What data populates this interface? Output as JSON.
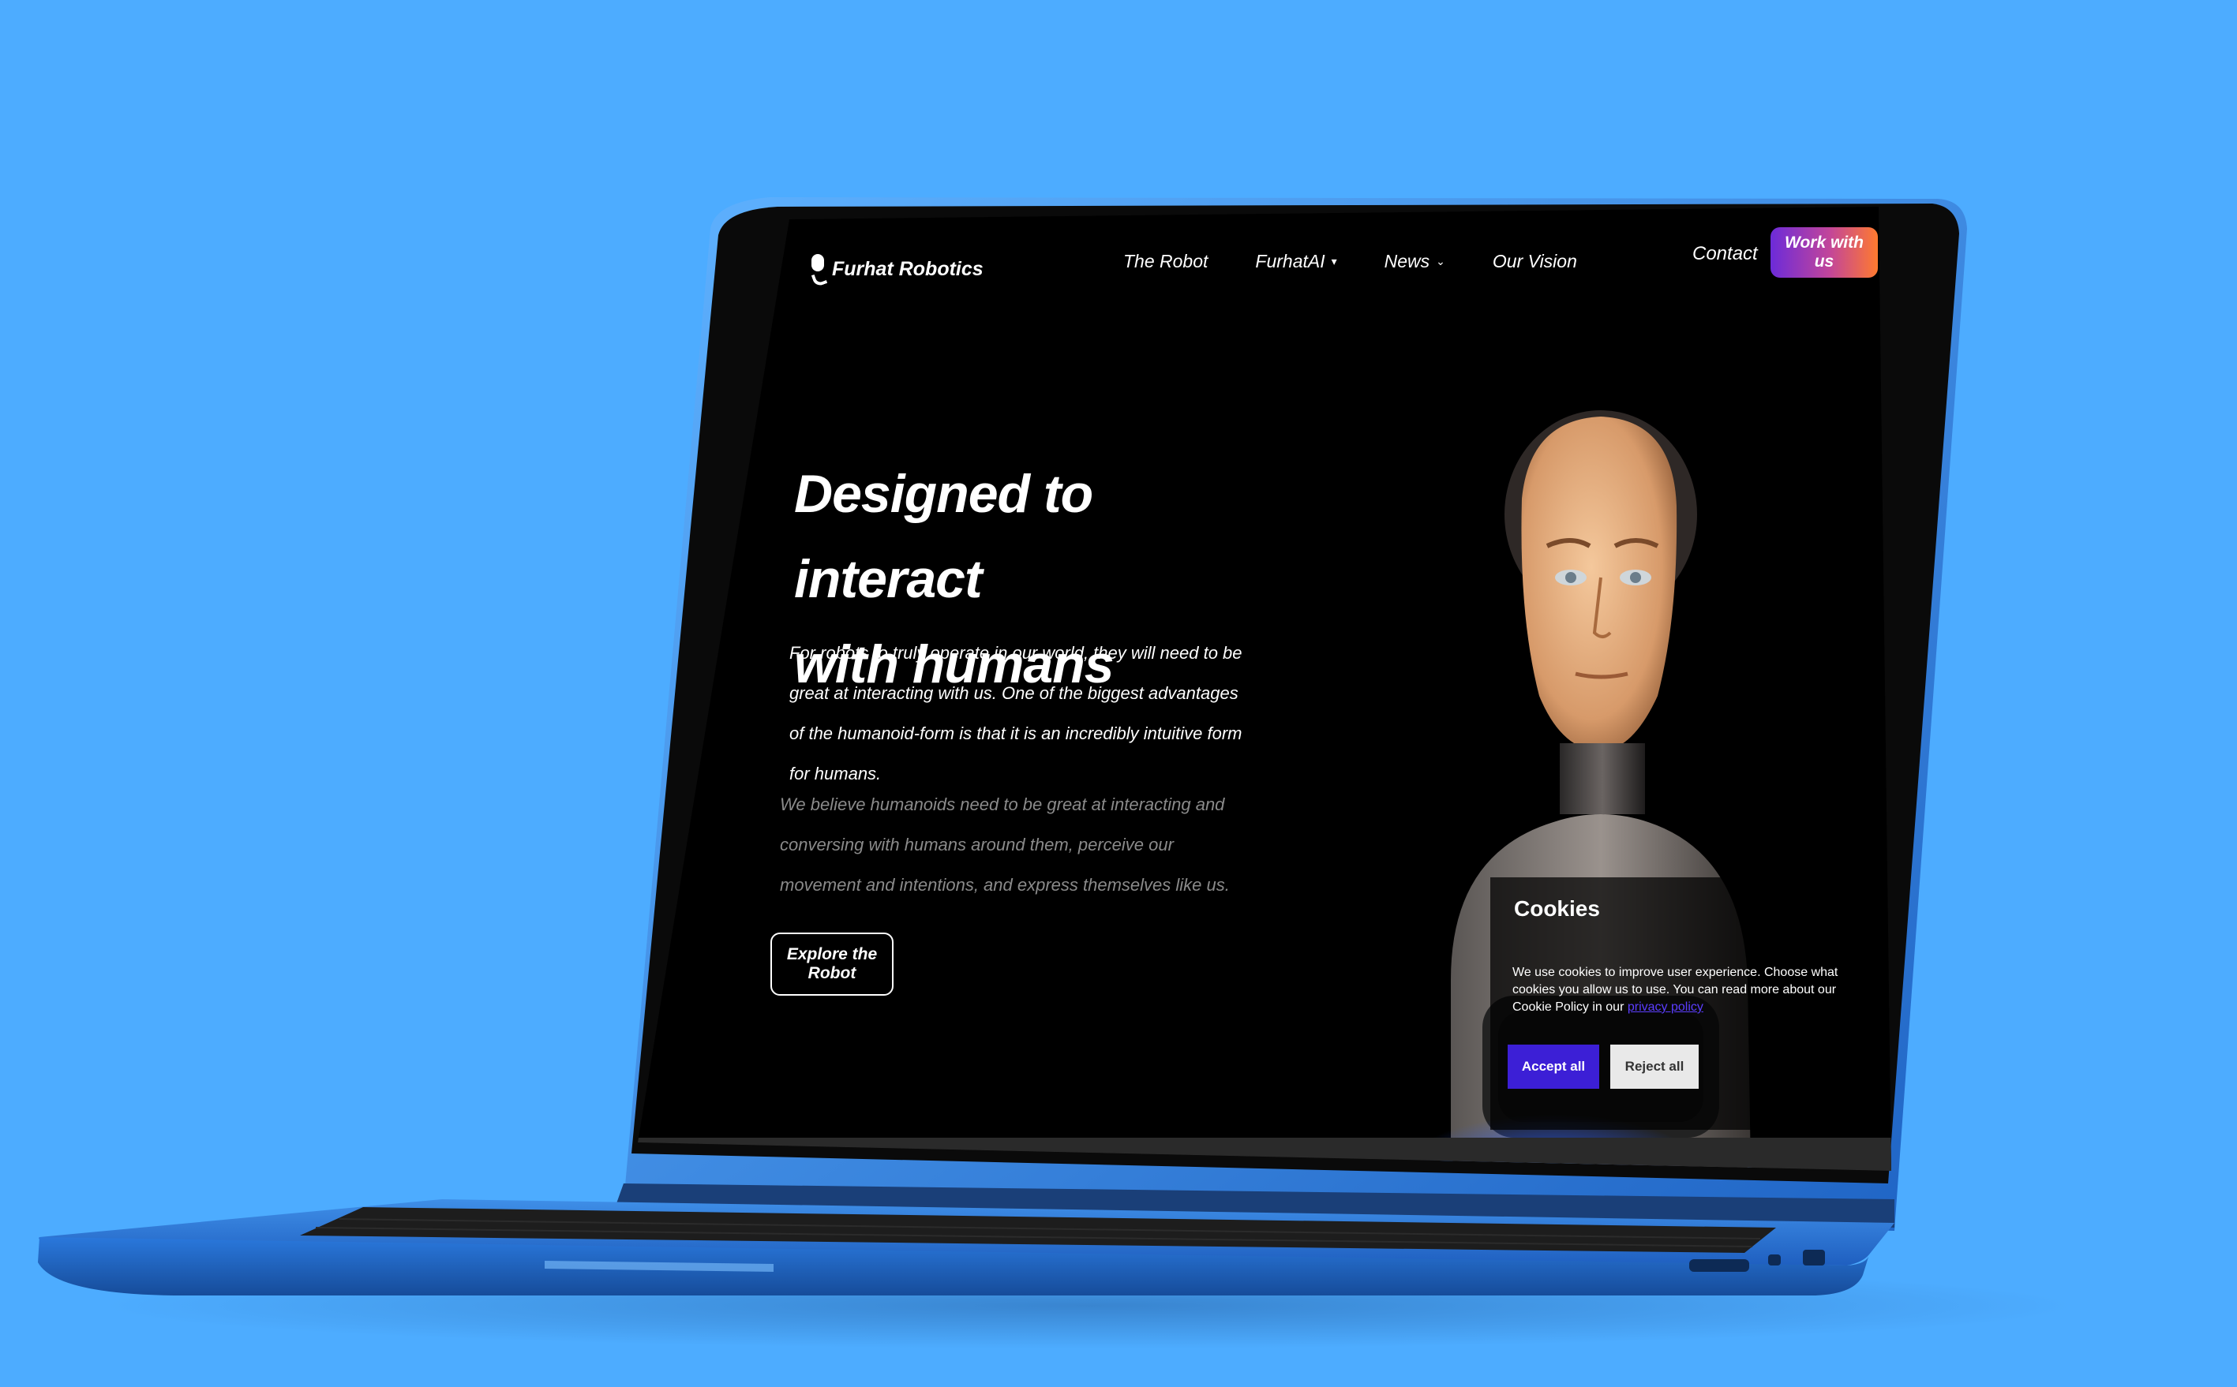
{
  "nav": {
    "logo": "Furhat Robotics",
    "links": [
      "The Robot",
      "FurhatAI",
      "News",
      "Our Vision"
    ],
    "contact": "Contact",
    "cta": "Work with us"
  },
  "hero": {
    "title_line1": "Designed to interact",
    "title_line2": "with humans",
    "paragraph1": "For robots to truly operate in our world, they will need to be great at interacting with us. One of the biggest advantages of the humanoid-form is that it is an incredibly intuitive form for humans.",
    "paragraph2": "We believe humanoids need to be great at interacting and conversing with humans around them, perceive our movement and intentions, and express themselves like us.",
    "button": "Explore the Robot"
  },
  "cookies": {
    "title": "Cookies",
    "text": "We use cookies to improve user experience. Choose what cookies you allow us to use. You can read more about our Cookie Policy in our",
    "link": "privacy policy",
    "accept": "Accept all",
    "reject": "Reject all"
  },
  "colors": {
    "background": "#4dacff",
    "laptop_body": "#2f7fe0",
    "screen": "#000000",
    "accept_button": "#3c1fd6",
    "cta_gradient_start": "#6c2bd9",
    "cta_gradient_end": "#ff7a2f"
  }
}
